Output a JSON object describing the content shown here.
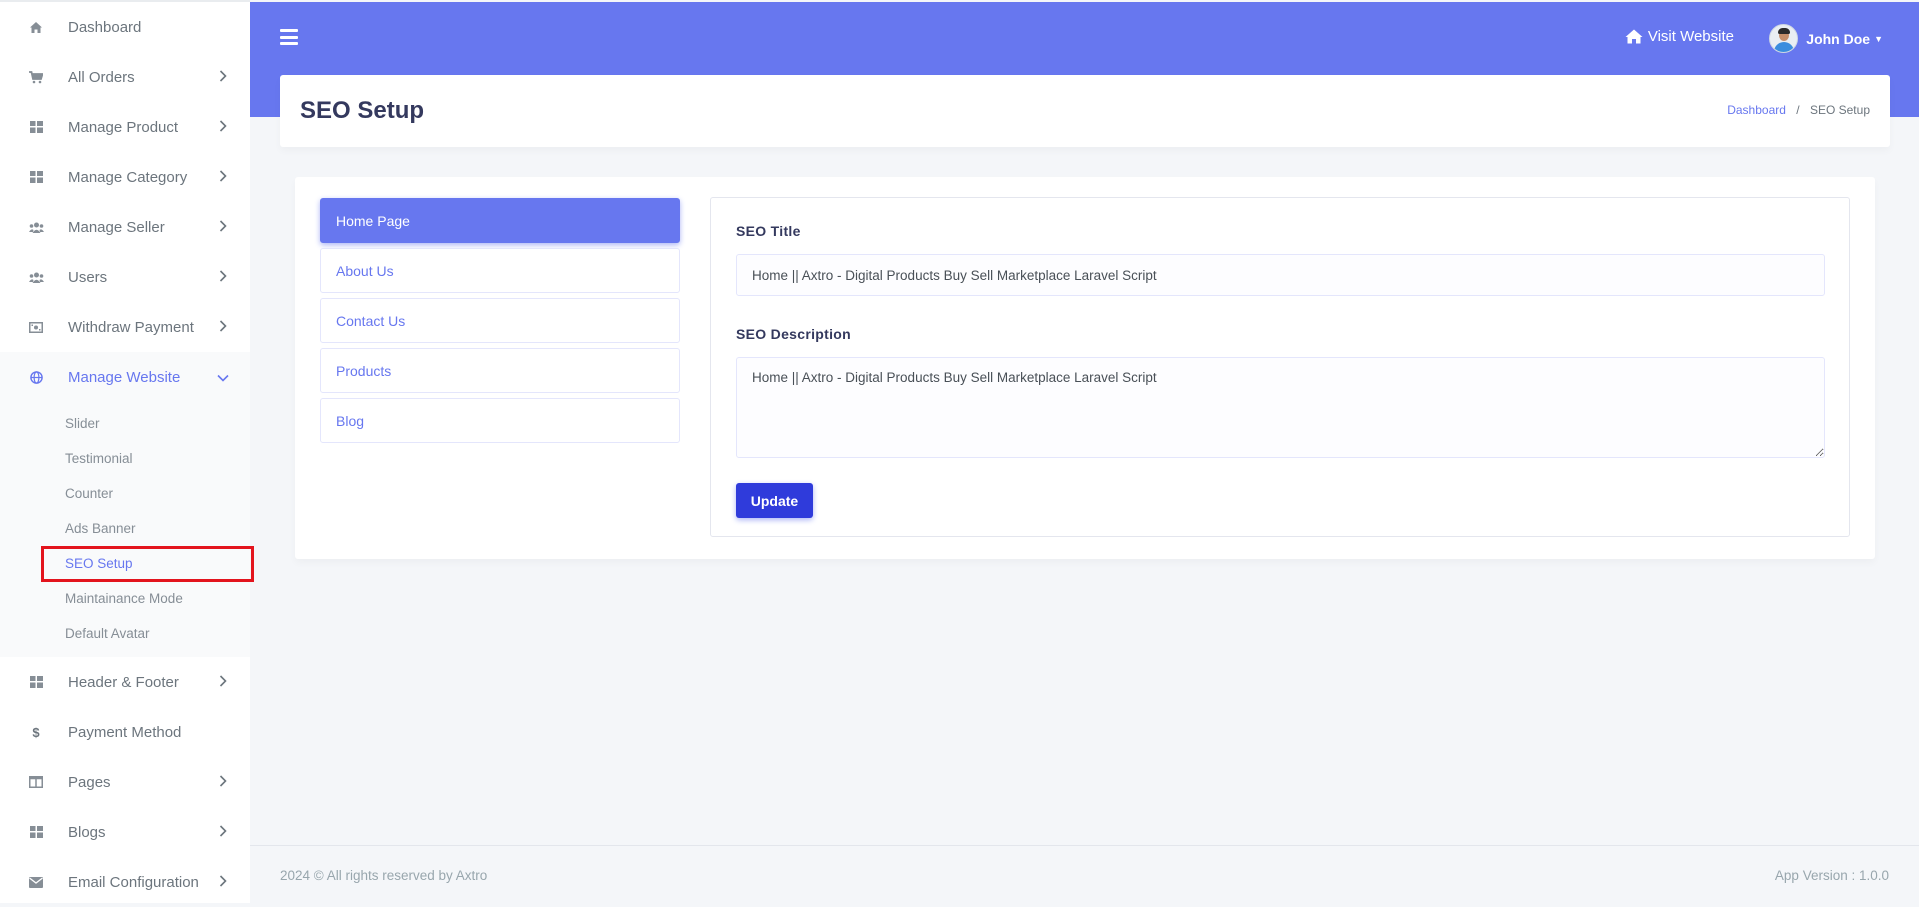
{
  "sidebar": {
    "items": [
      {
        "label": "Dashboard",
        "icon": "home-icon"
      },
      {
        "label": "All Orders",
        "icon": "cart-icon"
      },
      {
        "label": "Manage Product",
        "icon": "grid-icon"
      },
      {
        "label": "Manage Category",
        "icon": "grid-icon"
      },
      {
        "label": "Manage Seller",
        "icon": "users-icon"
      },
      {
        "label": "Users",
        "icon": "users-icon"
      },
      {
        "label": "Withdraw Payment",
        "icon": "money-icon"
      },
      {
        "label": "Manage Website",
        "icon": "globe-icon"
      },
      {
        "label": "Header & Footer",
        "icon": "grid-icon"
      },
      {
        "label": "Payment Method",
        "icon": "dollar-icon"
      },
      {
        "label": "Pages",
        "icon": "columns-icon"
      },
      {
        "label": "Blogs",
        "icon": "grid-icon"
      },
      {
        "label": "Email Configuration",
        "icon": "envelope-icon"
      }
    ],
    "submenu": [
      {
        "label": "Slider"
      },
      {
        "label": "Testimonial"
      },
      {
        "label": "Counter"
      },
      {
        "label": "Ads Banner"
      },
      {
        "label": "SEO Setup"
      },
      {
        "label": "Maintainance Mode"
      },
      {
        "label": "Default Avatar"
      }
    ]
  },
  "topbar": {
    "visit_label": "Visit Website",
    "user_name": "John Doe",
    "accent_color": "#6777ef"
  },
  "header": {
    "title": "SEO Setup",
    "breadcrumb": [
      "Dashboard",
      "SEO Setup"
    ],
    "breadcrumb_sep": "/"
  },
  "tabs": [
    "Home Page",
    "About Us",
    "Contact Us",
    "Products",
    "Blog"
  ],
  "form": {
    "title_label": "SEO Title",
    "title_value": "Home || Axtro - Digital Products Buy Sell Marketplace Laravel Script",
    "description_label": "SEO Description",
    "description_value": "Home || Axtro - Digital Products Buy Sell Marketplace Laravel Script",
    "update_label": "Update"
  },
  "footer": {
    "copyright": "2024 © All rights reserved by Axtro",
    "version": "App Version : 1.0.0"
  }
}
